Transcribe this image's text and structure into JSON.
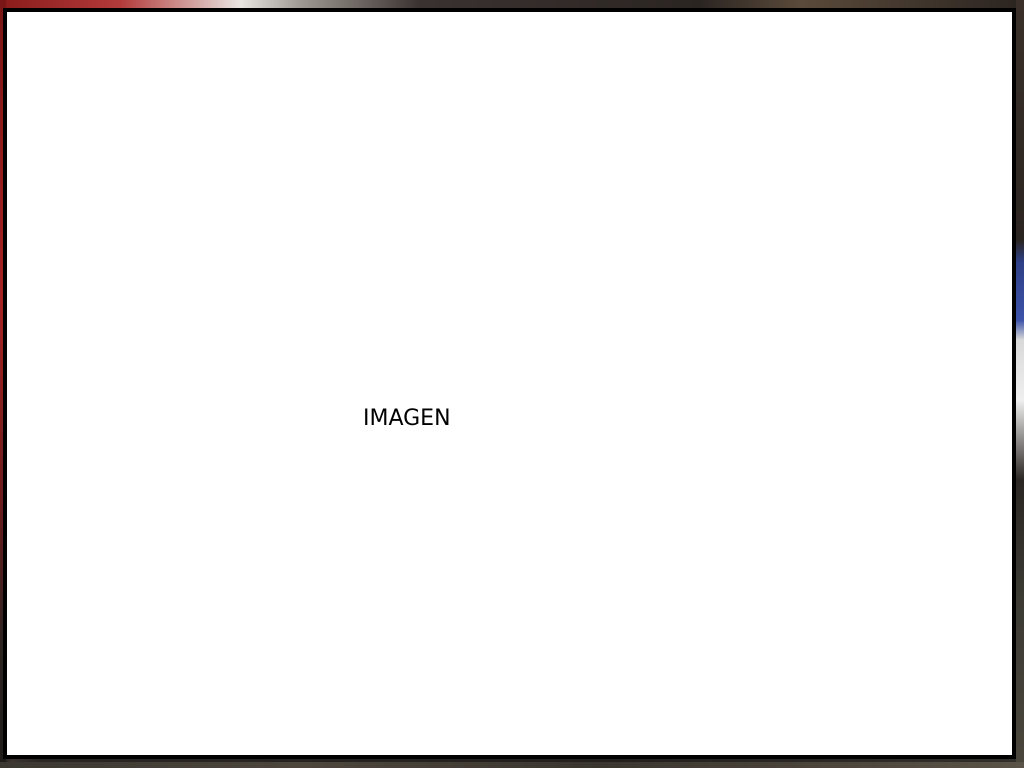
{
  "placeholder": {
    "label": "IMAGEN"
  },
  "colors": {
    "frame_border": "#000000",
    "frame_background": "#ffffff",
    "label_text": "#000000"
  }
}
